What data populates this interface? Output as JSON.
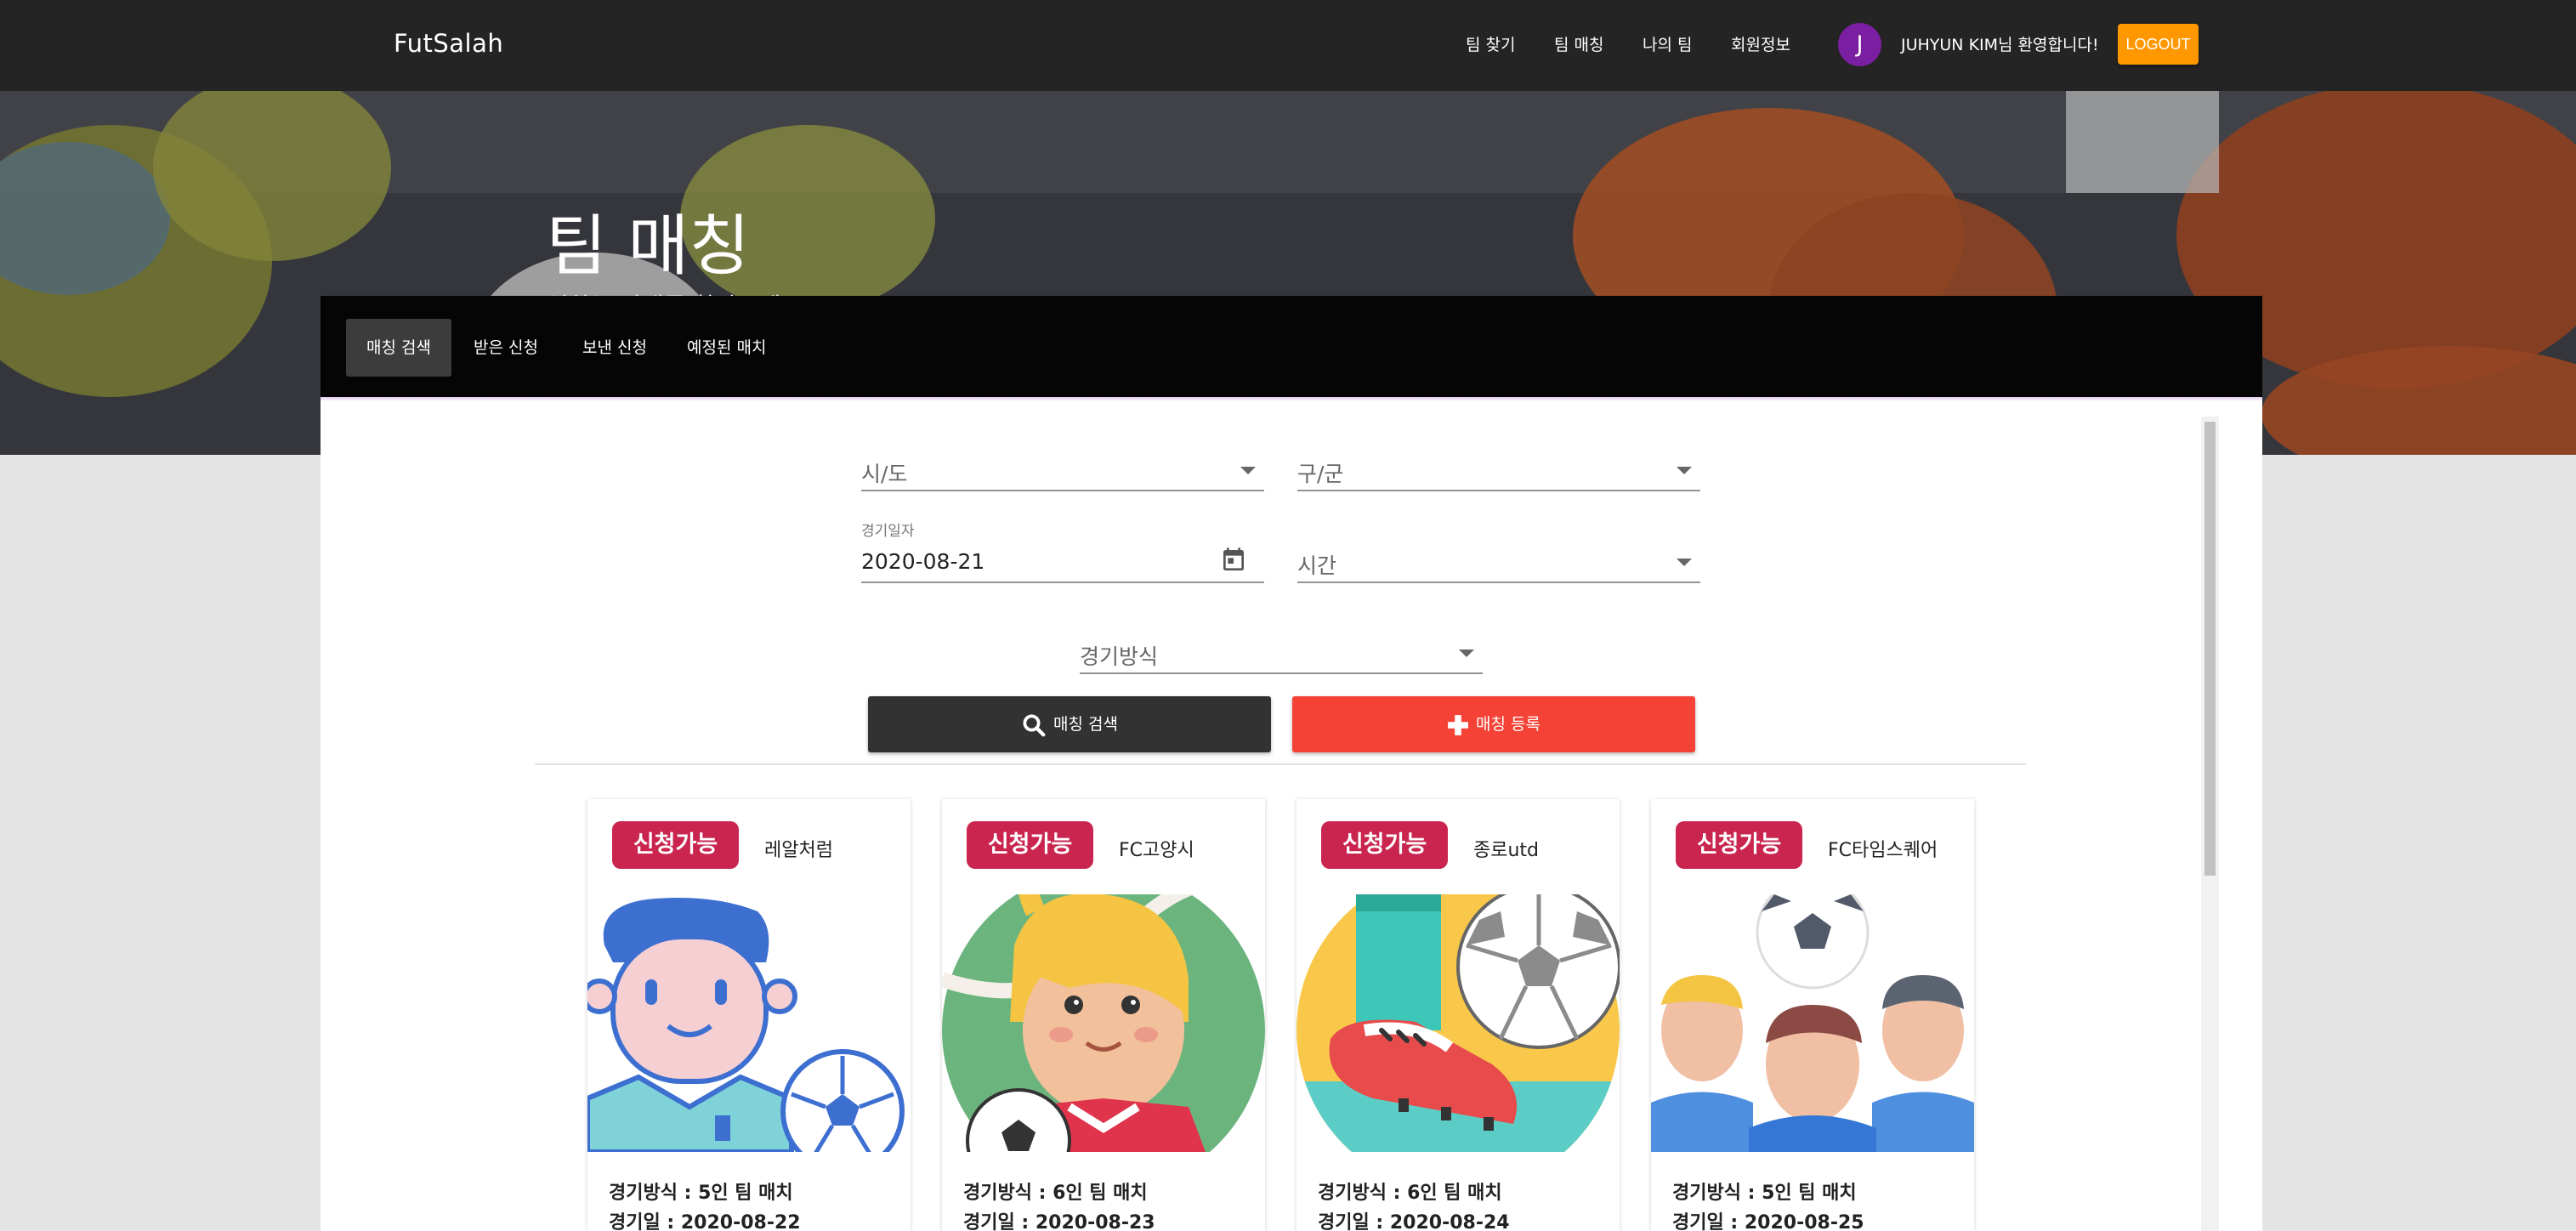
{
  "navbar": {
    "brand": "FutSalah",
    "links": [
      "팀 찾기",
      "팀 매칭",
      "나의 팀",
      "회원정보"
    ],
    "avatar_initial": "J",
    "welcome": "JUHYUN KIM님 환영합니다!",
    "logout_label": "LOGOUT"
  },
  "hero": {
    "title": "팀 매칭",
    "subtitle": "원하는 상대를 찾아보세요."
  },
  "tabs": [
    "매칭 검색",
    "받은 신청",
    "보낸 신청",
    "예정된 매치"
  ],
  "form": {
    "sido_label": "시/도",
    "gugun_label": "구/군",
    "date_label": "경기일자",
    "date_value": "2020-08-21",
    "time_label": "시간",
    "method_label": "경기방식"
  },
  "buttons": {
    "search_label": "매칭 검색",
    "register_label": "매칭 등록"
  },
  "cards": [
    {
      "status": "신청가능",
      "team": "레알처럼",
      "method_text": "경기방식 : 5인 팀 매치",
      "date_text": "경기일 : 2020-08-22"
    },
    {
      "status": "신청가능",
      "team": "FC고양시",
      "method_text": "경기방식 : 6인 팀 매치",
      "date_text": "경기일 : 2020-08-23"
    },
    {
      "status": "신청가능",
      "team": "종로utd",
      "method_text": "경기방식 : 6인 팀 매치",
      "date_text": "경기일 : 2020-08-24"
    },
    {
      "status": "신청가능",
      "team": "FC타임스퀘어",
      "method_text": "경기방식 : 5인 팀 매치",
      "date_text": "경기일 : 2020-08-25"
    }
  ],
  "colors": {
    "navbar_bg": "#242424",
    "logout_bg": "#ff9800",
    "avatar_bg": "#7b1fa2",
    "search_btn": "#323232",
    "register_btn": "#f44336",
    "status_chip": "#c9254f"
  },
  "icons": [
    "search-icon",
    "plus-icon",
    "calendar-icon",
    "chevron-down-icon"
  ]
}
